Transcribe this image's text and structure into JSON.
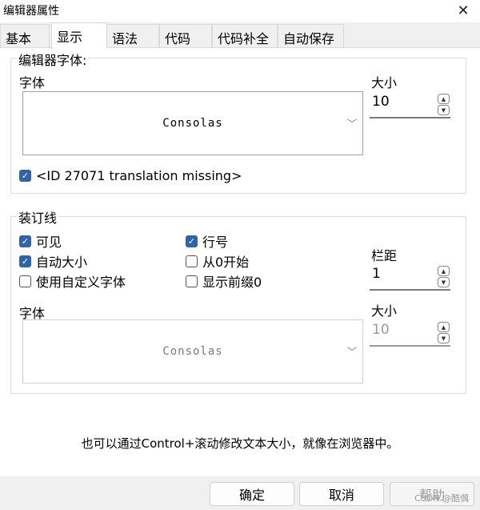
{
  "window": {
    "title": "编辑器属性",
    "close_icon": "close-icon"
  },
  "tabs": [
    {
      "label": "基本",
      "active": false
    },
    {
      "label": "显示",
      "active": true
    },
    {
      "label": "语法",
      "active": false
    },
    {
      "label": "代码",
      "active": false
    },
    {
      "label": "代码补全",
      "active": false
    },
    {
      "label": "自动保存",
      "active": false
    }
  ],
  "editor_font": {
    "group_title": "编辑器字体:",
    "font_label": "字体",
    "font_value": "Consolas",
    "size_label": "大小",
    "size_value": "10",
    "option_label": "<ID 27071 translation missing>",
    "option_checked": true
  },
  "gutter": {
    "group_title": "装订线",
    "visible_label": "可见",
    "visible_checked": true,
    "auto_size_label": "自动大小",
    "auto_size_checked": true,
    "custom_font_label": "使用自定义字体",
    "custom_font_checked": false,
    "line_numbers_label": "行号",
    "line_numbers_checked": true,
    "start_zero_label": "从0开始",
    "start_zero_checked": false,
    "show_prefix_label": "显示前缀0",
    "show_prefix_checked": false,
    "margin_label": "栏距",
    "margin_value": "1",
    "font_label": "字体",
    "font_value": "Consolas",
    "size_label": "大小",
    "size_value": "10"
  },
  "hint_text": "也可以通过Control+滚动修改文本大小，就像在浏览器中。",
  "buttons": {
    "ok": "确定",
    "cancel": "取消",
    "help": "帮助"
  },
  "watermark": "CSDN @酷偶",
  "colors": {
    "checkbox_accent": "#2f64a6",
    "panel_bg": "#ffffff",
    "window_bg": "#f0f0f0"
  }
}
